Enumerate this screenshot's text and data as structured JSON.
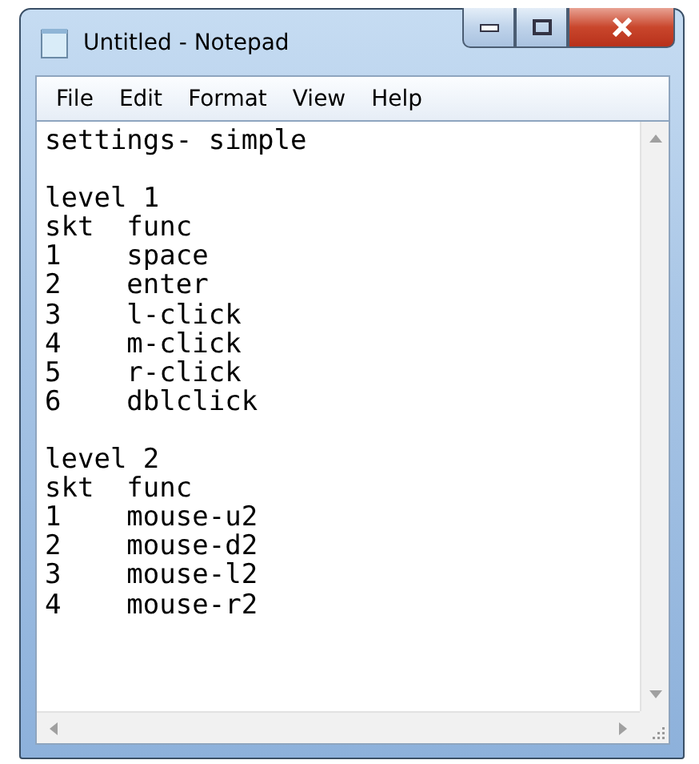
{
  "window": {
    "title": "Untitled - Notepad"
  },
  "menu": [
    "File",
    "Edit",
    "Format",
    "View",
    "Help"
  ],
  "document": {
    "heading": "settings- simple",
    "sections": [
      {
        "title": "level 1",
        "header": [
          "skt",
          "func"
        ],
        "rows": [
          [
            "1",
            "space"
          ],
          [
            "2",
            "enter"
          ],
          [
            "3",
            "l-click"
          ],
          [
            "4",
            "m-click"
          ],
          [
            "5",
            "r-click"
          ],
          [
            "6",
            "dblclick"
          ]
        ]
      },
      {
        "title": "level 2",
        "header": [
          "skt",
          "func"
        ],
        "rows": [
          [
            "1",
            "mouse-u2"
          ],
          [
            "2",
            "mouse-d2"
          ],
          [
            "3",
            "mouse-l2"
          ],
          [
            "4",
            "mouse-r2"
          ]
        ]
      }
    ]
  }
}
